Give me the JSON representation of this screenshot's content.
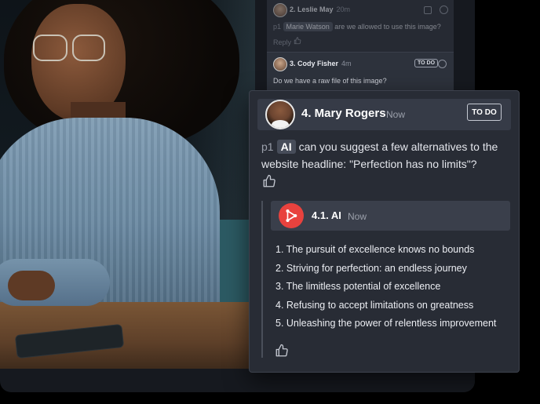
{
  "back_comments": [
    {
      "number_name": "2. Leslie May",
      "time": "20m",
      "mention_prefix": "p1",
      "mention": "Marie Watson",
      "text": "are we allowed to use this image?",
      "reply_label": "Reply"
    },
    {
      "number_name": "3. Cody Fisher",
      "time": "4m",
      "status": "TO DO",
      "text": "Do we have a raw file of this image?"
    }
  ],
  "main_comment": {
    "number_name": "4. Mary Rogers",
    "time": "Now",
    "status": "TO DO",
    "page_ref": "p1",
    "mention": "AI",
    "text": "can you suggest a few alternatives to the website headline: \"Perfection has no limits\"?"
  },
  "ai_reply": {
    "number_name": "4.1. AI",
    "time": "Now",
    "suggestions": [
      "1. The pursuit of excellence knows no bounds",
      "2. Striving for perfection: an endless journey",
      "3. The limitless potential of excellence",
      "4. Refusing to accept limitations on greatness",
      "5. Unleashing the power of relentless improvement"
    ]
  },
  "icons": {
    "like": "thumbs-up-icon",
    "ai_logo": "ai-triangle-nodes-icon",
    "resolve": "circle-icon"
  },
  "colors": {
    "card_bg": "#282c35",
    "header_bg": "#363b47",
    "ai_accent": "#e8423e"
  }
}
